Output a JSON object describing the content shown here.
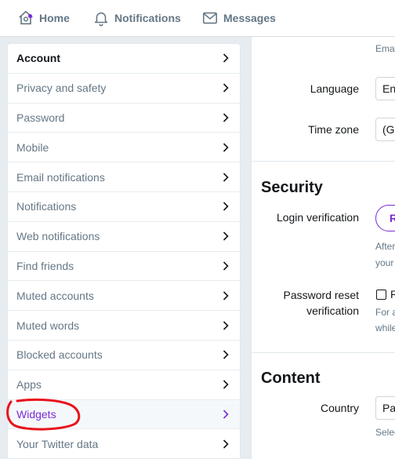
{
  "topnav": {
    "home_label": "Home",
    "notifications_label": "Notifications",
    "messages_label": "Messages",
    "accent": "#7b2bd6"
  },
  "sidebar": {
    "items": [
      {
        "label": "Account"
      },
      {
        "label": "Privacy and safety"
      },
      {
        "label": "Password"
      },
      {
        "label": "Mobile"
      },
      {
        "label": "Email notifications"
      },
      {
        "label": "Notifications"
      },
      {
        "label": "Web notifications"
      },
      {
        "label": "Find friends"
      },
      {
        "label": "Muted accounts"
      },
      {
        "label": "Muted words"
      },
      {
        "label": "Blocked accounts"
      },
      {
        "label": "Apps"
      },
      {
        "label": "Widgets"
      },
      {
        "label": "Your Twitter data"
      }
    ],
    "active_index": 0,
    "highlight_index": 12,
    "highlight_color": "#7b2bd6",
    "annotation_color": "#e8131b"
  },
  "content": {
    "email_hint": "Emai",
    "language_label": "Language",
    "language_value": "En",
    "timezone_label": "Time zone",
    "timezone_value": "(G",
    "security_title": "Security",
    "login_verification_label": "Login verification",
    "login_verification_button": "R",
    "login_help_1": "After",
    "login_help_2": "your",
    "password_reset_label_1": "Password reset",
    "password_reset_label_2": "verification",
    "password_reset_checkbox_text": "R",
    "password_help_1": "For a",
    "password_help_2": "while",
    "content_title": "Content",
    "country_label": "Country",
    "country_value": "Pa",
    "country_help": "Selec"
  }
}
